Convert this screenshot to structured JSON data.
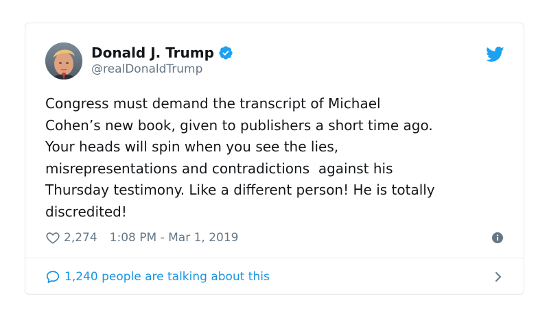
{
  "tweet": {
    "display_name": "Donald J. Trump",
    "handle": "@realDonaldTrump",
    "verified": true,
    "text": "Congress must demand the transcript of Michael\nCohen’s new book, given to publishers a short time ago.\nYour heads will spin when you see the lies,\nmisrepresentations and contradictions  against his\nThursday testimony. Like a different person! He is totally\ndiscredited!",
    "like_count": "2,274",
    "timestamp": "1:08 PM - Mar 1, 2019",
    "conversation_label": "1,240 people are talking about this"
  },
  "icons": {
    "verified": "verified-badge-icon",
    "brand": "twitter-bird-icon",
    "like": "heart-icon",
    "info": "info-icon",
    "reply": "speech-bubble-icon",
    "chevron": "chevron-right-icon"
  },
  "colors": {
    "accent": "#1da1f2",
    "link": "#1b95e0",
    "muted": "#657786",
    "text": "#14171a",
    "border": "#e1e8ed"
  }
}
